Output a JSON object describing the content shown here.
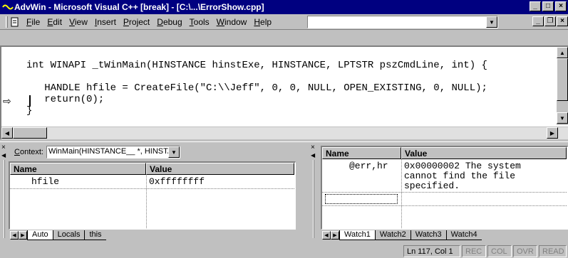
{
  "window": {
    "title": "AdvWin - Microsoft Visual C++ [break] - [C:\\...\\ErrorShow.cpp]"
  },
  "menu": {
    "items": [
      {
        "label": "File",
        "accel": "F",
        "rest": "ile"
      },
      {
        "label": "Edit",
        "accel": "E",
        "rest": "dit"
      },
      {
        "label": "View",
        "accel": "V",
        "rest": "iew"
      },
      {
        "label": "Insert",
        "accel": "I",
        "rest": "nsert"
      },
      {
        "label": "Project",
        "accel": "P",
        "rest": "roject"
      },
      {
        "label": "Debug",
        "accel": "D",
        "rest": "ebug"
      },
      {
        "label": "Tools",
        "accel": "T",
        "rest": "ools"
      },
      {
        "label": "Window",
        "accel": "W",
        "rest": "indow"
      },
      {
        "label": "Help",
        "accel": "H",
        "rest": "elp"
      }
    ],
    "combo_value": ""
  },
  "editor": {
    "lines": [
      "int WINAPI _tWinMain(HINSTANCE hinstExe, HINSTANCE, LPTSTR pszCmdLine, int) {",
      "   HANDLE hfile = CreateFile(\"C:\\\\Jeff\", 0, 0, NULL, OPEN_EXISTING, 0, NULL);",
      "   return(0);",
      "}"
    ]
  },
  "variables": {
    "context_label": "Context:",
    "context_accel": "C",
    "context_rest": "ontext:",
    "context_value": "WinMain(HINSTANCE__ *, HINSTANCE__ *, char *",
    "columns": [
      "Name",
      "Value"
    ],
    "rows": [
      {
        "name": "hfile",
        "value": "0xffffffff"
      }
    ],
    "tabs": [
      "Auto",
      "Locals",
      "this"
    ]
  },
  "watch": {
    "columns": [
      "Name",
      "Value"
    ],
    "rows": [
      {
        "name": "@err,hr",
        "value_lines": [
          "0x00000002 The system",
          "cannot find the file",
          "specified."
        ]
      }
    ],
    "tabs": [
      "Watch1",
      "Watch2",
      "Watch3",
      "Watch4"
    ]
  },
  "status": {
    "position": "Ln 117, Col 1",
    "indicators": [
      "REC",
      "COL",
      "OVR",
      "READ"
    ]
  }
}
